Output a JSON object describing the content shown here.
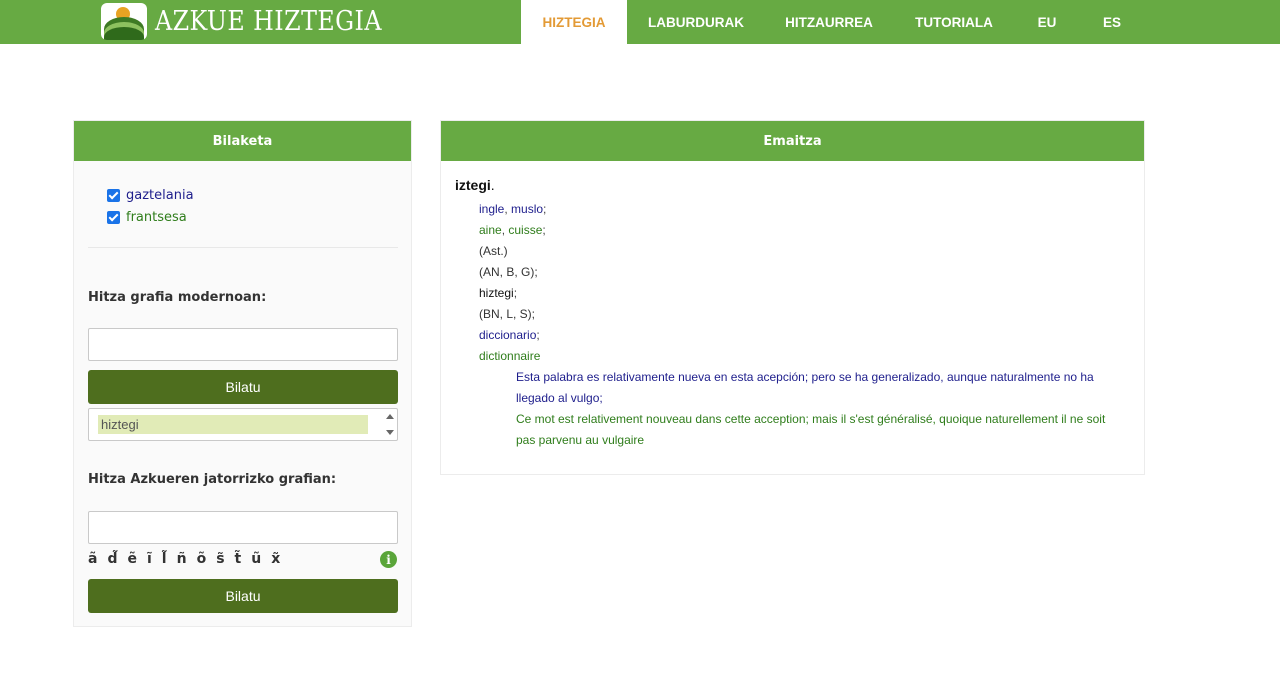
{
  "header": {
    "brand": "AZKUE HIZTEGIA",
    "nav": [
      {
        "label": "HIZTEGIA",
        "active": true
      },
      {
        "label": "LABURDURAK",
        "active": false
      },
      {
        "label": "HITZAURREA",
        "active": false
      },
      {
        "label": "TUTORIALA",
        "active": false
      },
      {
        "label": "EU",
        "active": false
      },
      {
        "label": "ES",
        "active": false
      }
    ]
  },
  "search_panel": {
    "title": "Bilaketa",
    "languages": [
      {
        "label": "gaztelania",
        "checked": true,
        "color": "#1e1e8c"
      },
      {
        "label": "frantsesa",
        "checked": true,
        "color": "#2f7d1b"
      }
    ],
    "modern_label": "Hitza grafia modernoan:",
    "modern_input_value": "",
    "modern_button": "Bilatu",
    "suggestions": [
      "hiztegi"
    ],
    "original_label": "Hitza Azkueren jatorrizko grafian:",
    "original_input_value": "",
    "special_chars": [
      "ã",
      "d̃",
      "ẽ",
      "ĩ",
      "l̃",
      "ñ",
      "õ",
      "s̃",
      "t̃",
      "ũ",
      "x̃"
    ],
    "original_button": "Bilatu",
    "info_icon": "info-icon"
  },
  "result_panel": {
    "title": "Emaitza",
    "headword": "iztegi",
    "headword_punct": ".",
    "es_translation": {
      "a": "ingle",
      "b": "muslo",
      "sep": ", ",
      "end": ";"
    },
    "fr_translation": {
      "a": "aine",
      "b": "cuisse",
      "sep": ", ",
      "end": ";"
    },
    "region1": "(Ast.)",
    "region2": "(AN, B, G);",
    "ref_word": "hiztegi",
    "ref_end": ";",
    "region3": "(BN, L, S);",
    "es_meaning": "diccionario",
    "es_meaning_end": ";",
    "fr_meaning": "dictionnaire",
    "note_es": "Esta palabra es relativamente nueva en esta acepción; pero se ha generalizado, aunque naturalmente no ha llegado al vulgo;",
    "note_fr": "Ce mot est relativement nouveau dans cette acception; mais il s'est généralisé, quoique naturellement il ne soit pas parvenu au vulgaire"
  }
}
